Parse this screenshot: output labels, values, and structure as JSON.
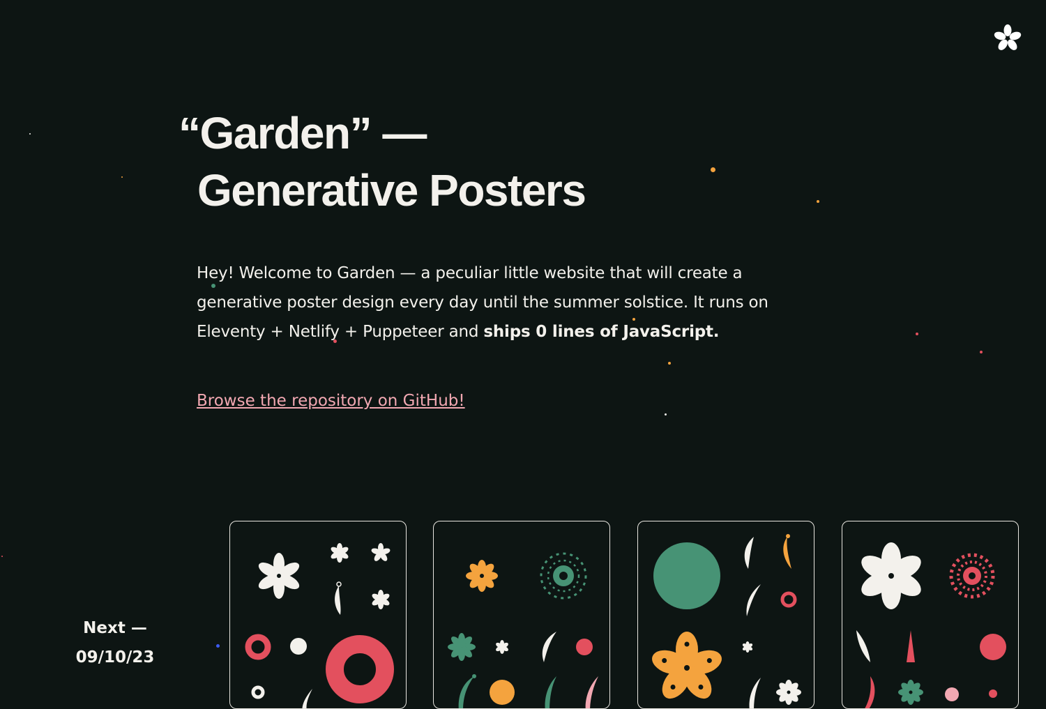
{
  "logo": {
    "icon": "flower-icon",
    "color": "#ffffff"
  },
  "hero": {
    "title_line1": "“Garden” —",
    "title_line2": "Generative Posters"
  },
  "intro": {
    "text_plain": "Hey! Welcome to Garden — a peculiar little website that will create a generative poster design every day until the summer solstice. It runs on Eleventy + Netlify + Puppeteer and ",
    "text_bold": "ships 0 lines of JavaScript."
  },
  "links": {
    "github": "Browse the repository on GitHub!"
  },
  "nav": {
    "next_label": "Next —",
    "next_date": "09/10/23"
  },
  "colors": {
    "background": "#0d1513",
    "text": "#f3f1ec",
    "link": "#f2a8b2",
    "red": "#e3505e",
    "green": "#479375",
    "orange": "#f4a33e",
    "white": "#f3f1ec",
    "pink": "#f2a8b2",
    "blue": "#3d5bf0"
  },
  "posters": [
    {
      "icon": "poster-thumbnail",
      "palette": [
        "white",
        "red"
      ]
    },
    {
      "icon": "poster-thumbnail",
      "palette": [
        "orange",
        "green",
        "white",
        "red",
        "pink"
      ]
    },
    {
      "icon": "poster-thumbnail",
      "palette": [
        "green",
        "white",
        "orange",
        "red"
      ]
    },
    {
      "icon": "poster-thumbnail",
      "palette": [
        "white",
        "red",
        "green",
        "pink"
      ]
    }
  ]
}
